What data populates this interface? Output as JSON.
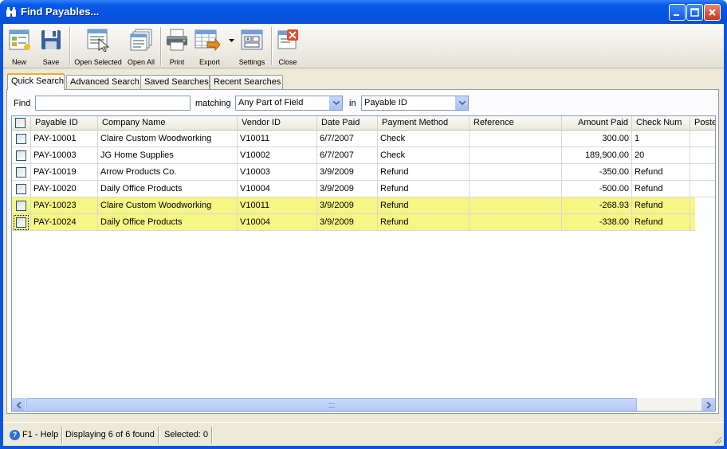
{
  "window": {
    "title": "Find Payables..."
  },
  "toolbar": {
    "new": "New",
    "save": "Save",
    "open_selected": "Open Selected",
    "open_all": "Open All",
    "print": "Print",
    "export": "Export",
    "settings": "Settings",
    "close": "Close"
  },
  "tabs": [
    {
      "label": "Quick Search",
      "active": true
    },
    {
      "label": "Advanced Search",
      "active": false
    },
    {
      "label": "Saved Searches",
      "active": false
    },
    {
      "label": "Recent Searches",
      "active": false
    }
  ],
  "search": {
    "find_label": "Find",
    "find_value": "",
    "matching_label": "matching",
    "matching_value": "Any Part of Field",
    "in_label": "in",
    "in_value": "Payable ID"
  },
  "grid": {
    "columns": [
      "Payable ID",
      "Company Name",
      "Vendor ID",
      "Date Paid",
      "Payment Method",
      "Reference",
      "Amount Paid",
      "Check Num",
      "Poste"
    ],
    "rows": [
      {
        "payable_id": "PAY-10001",
        "company": "Claire Custom Woodworking",
        "vendor_id": "V10011",
        "date_paid": "6/7/2007",
        "method": "Check",
        "reference": "",
        "amount": "300.00",
        "check_num": "1",
        "highlighted": false
      },
      {
        "payable_id": "PAY-10003",
        "company": "JG Home Supplies",
        "vendor_id": "V10002",
        "date_paid": "6/7/2007",
        "method": "Check",
        "reference": "",
        "amount": "189,900.00",
        "check_num": "20",
        "highlighted": false
      },
      {
        "payable_id": "PAY-10019",
        "company": "Arrow Products Co.",
        "vendor_id": "V10003",
        "date_paid": "3/9/2009",
        "method": "Refund",
        "reference": "",
        "amount": "-350.00",
        "check_num": "Refund",
        "highlighted": false
      },
      {
        "payable_id": "PAY-10020",
        "company": "Daily Office Products",
        "vendor_id": "V10004",
        "date_paid": "3/9/2009",
        "method": "Refund",
        "reference": "",
        "amount": "-500.00",
        "check_num": "Refund",
        "highlighted": false
      },
      {
        "payable_id": "PAY-10023",
        "company": "Claire Custom Woodworking",
        "vendor_id": "V10011",
        "date_paid": "3/9/2009",
        "method": "Refund",
        "reference": "",
        "amount": "-268.93",
        "check_num": "Refund",
        "highlighted": true
      },
      {
        "payable_id": "PAY-10024",
        "company": "Daily Office Products",
        "vendor_id": "V10004",
        "date_paid": "3/9/2009",
        "method": "Refund",
        "reference": "",
        "amount": "-338.00",
        "check_num": "Refund",
        "highlighted": true
      }
    ]
  },
  "statusbar": {
    "help": "F1 - Help",
    "displaying": "Displaying 6 of 6 found",
    "selected": "Selected: 0"
  },
  "colors": {
    "titlebar": "#0554e2",
    "highlight_row": "#f6f684",
    "active_tab_accent": "#f7a835"
  }
}
